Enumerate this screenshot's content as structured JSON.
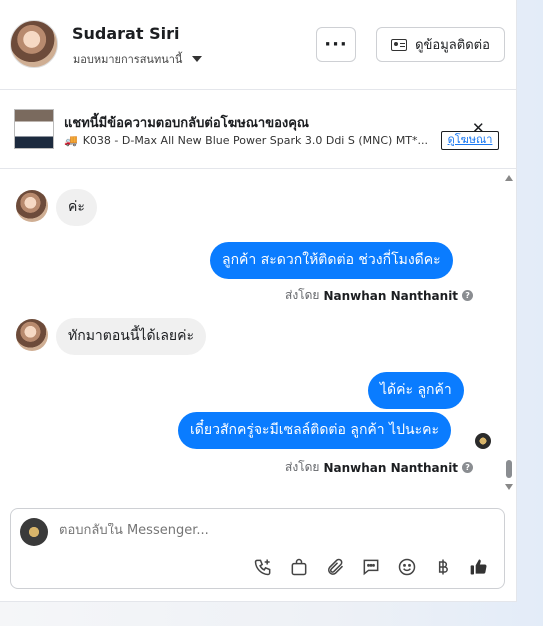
{
  "header": {
    "name": "Sudarat Siri",
    "assign_label": "มอบหมายการสนทนานี้",
    "more_label": "···",
    "contact_button": "ดูข้อมูลติดต่อ"
  },
  "ad_banner": {
    "title": "แชทนี้มีข้อความตอบกลับต่อโฆษณาของคุณ",
    "description": "K038 - D-Max All New Blue Power Spark 3.0 Ddi S (MNC) MT*...",
    "view_ad_link": "ดูโฆษณา",
    "close_label": "✕"
  },
  "messages": [
    {
      "direction": "in",
      "text": "ค่ะ"
    },
    {
      "direction": "out",
      "text": "ลูกค้า  สะดวกให้ติดต่อ ช่วงกี่โมงดีคะ"
    },
    {
      "direction": "in",
      "text": "ทักมาตอนนี้ได้เลยค่ะ"
    },
    {
      "direction": "out",
      "text": "ได้ค่ะ  ลูกค้า"
    },
    {
      "direction": "out",
      "text": "เดี๋ยวสักครู่จะมีเซลล์ติดต่อ ลูกค้า  ไปนะคะ"
    }
  ],
  "sent_by": {
    "prefix": "ส่งโดย",
    "sender": "Nanwhan Nanthanit",
    "help_glyph": "?"
  },
  "composer": {
    "placeholder": "ตอบกลับใน Messenger..."
  },
  "toolbar_icons": [
    "call-add-icon",
    "shopping-bag-icon",
    "attachment-icon",
    "saved-reply-icon",
    "emoji-icon",
    "baht-payment-icon",
    "thumbs-up-icon"
  ],
  "colors": {
    "outgoing_bubble": "#0a7cff",
    "incoming_bubble": "#f0f0f0",
    "link": "#1877f2"
  }
}
